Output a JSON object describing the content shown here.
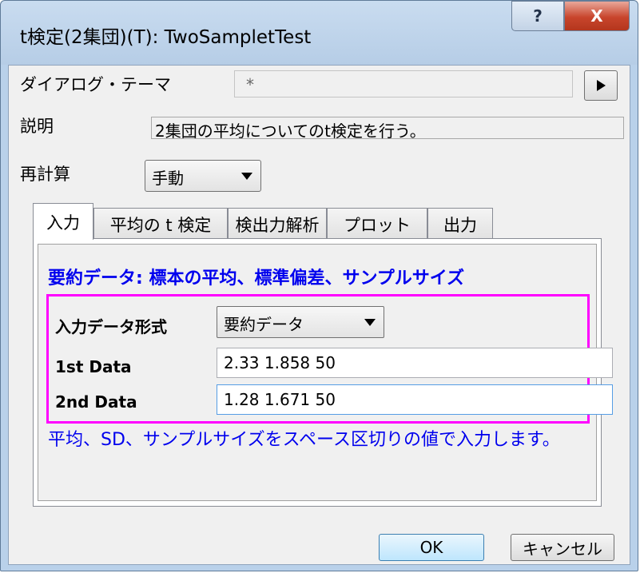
{
  "window": {
    "title": "t検定(2集団)(T): TwoSampletTest",
    "help_glyph": "?",
    "close_glyph": "X"
  },
  "dialog": {
    "theme_label": "ダイアログ・テーマ",
    "theme_value": "*",
    "theme_button_icon": "play-arrow-icon",
    "description_label": "説明",
    "description_value": "2集団の平均についてのt検定を行う。",
    "recalc_label": "再計算",
    "recalc_value": "手動"
  },
  "tabs": [
    {
      "label": "入力",
      "active": true
    },
    {
      "label": "平均の t 検定",
      "active": false
    },
    {
      "label": "検出力解析",
      "active": false
    },
    {
      "label": "プロット",
      "active": false
    },
    {
      "label": "出力",
      "active": false
    }
  ],
  "input_tab": {
    "heading": "要約データ: 標本の平均、標準偏差、サンプルサイズ",
    "format_label": "入力データ形式",
    "format_value": "要約データ",
    "first_label": "1st Data",
    "first_value": "2.33 1.858 50",
    "second_label": "2nd Data",
    "second_value": "1.28 1.671 50",
    "hint": "平均、SD、サンプルサイズをスペース区切りの値で入力します。"
  },
  "buttons": {
    "ok": "OK",
    "cancel": "キャンセル"
  },
  "colors": {
    "highlight": "#ff00ff",
    "heading_text": "#0000ee",
    "close_button": "#c8452c"
  }
}
